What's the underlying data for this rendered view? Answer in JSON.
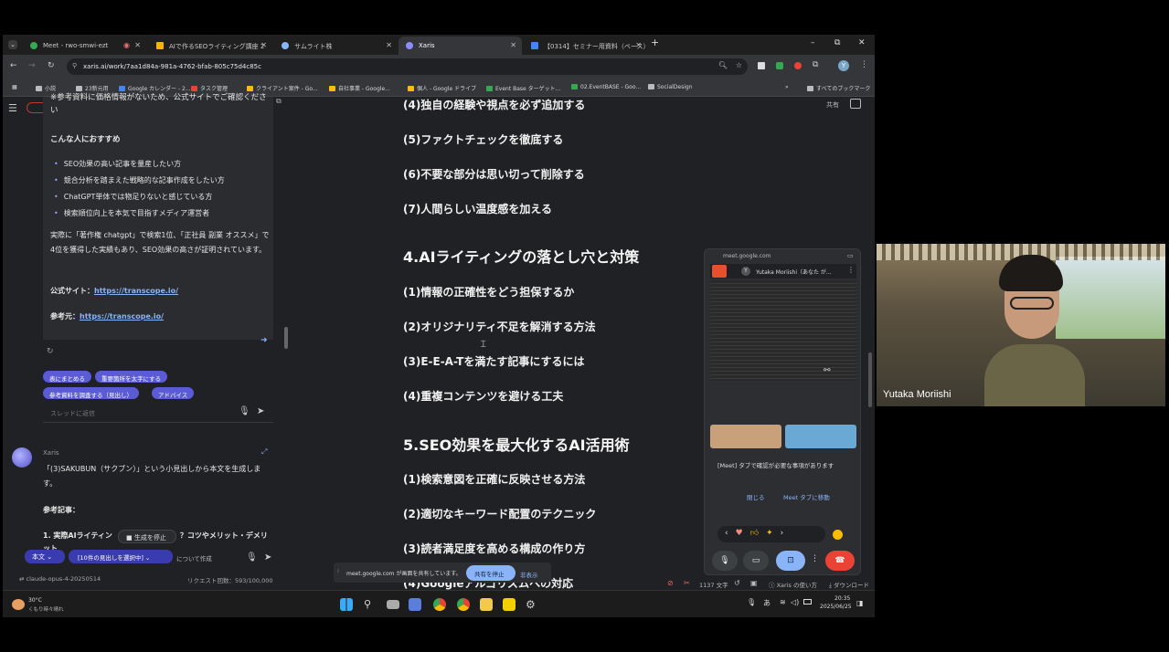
{
  "browser": {
    "tabs": [
      {
        "label": "Meet - rwo-smwi-ezt"
      },
      {
        "label": "AIで作るSEOライティング講座 2"
      },
      {
        "label": "サムライト株"
      },
      {
        "label": "Xaris"
      },
      {
        "label": "【0314】セミナー用資料（ベース）"
      }
    ],
    "url": "xaris.ai/work/7aa1d84a-981a-4762-bfab-805c75d4c85c",
    "bookmarks": [
      "小説",
      "23新元用",
      "Google カレンダー - 2...",
      "タスク管理",
      "クライアント案件 - Go...",
      "自社事業 - Google...",
      "個人 - Google ドライブ",
      "Event Base ターゲット...",
      "02.EventBASE - Goo...",
      "SocialDesign",
      "すべてのブックマーク"
    ]
  },
  "left_panel": {
    "note": "※参考資料に価格情報がないため、公式サイトでご確認ください",
    "recommend_title": "こんな人におすすめ",
    "recommend_items": [
      "SEO効果の高い記事を量産したい方",
      "競合分析を踏まえた戦略的な記事作成をしたい方",
      "ChatGPT単体では物足りないと感じている方",
      "検索順位向上を本気で目指すメディア運営者"
    ],
    "proof_text": "実際に「著作権 chatgpt」で検索1位、「正社員 副業 オススメ」で4位を獲得した実績もあり、SEO効果の高さが証明されています。",
    "official_label": "公式サイト：",
    "official_url": "https://transcope.io/",
    "ref_label": "参考元：",
    "ref_url": "https://transcope.io/",
    "chips": [
      "表にまとめる",
      "重要箇所を太字にする",
      "参考資料を調査する（見出し）",
      "アドバイス"
    ],
    "thread_placeholder": "スレッドに返信",
    "author": "Xaris",
    "reply": "「(3)SAKUBUN（サクブン）」という小見出しから本文を生成します。",
    "ref_articles_label": "参考記事：",
    "ref_article_1": "実際AIライティン",
    "ref_article_1_tail": "？コツやメリット・デメリット",
    "stop_button": "生成を停止",
    "mode_select": "本文",
    "heading_select": "10件の見出しを選択中",
    "heading_select_tail": "について作成",
    "model": "claude-opus-4-20250514",
    "request_count": "リクエスト回数：593/100,000"
  },
  "document": {
    "items_top": [
      "(4)独自の経験や視点を必ず追加する",
      "(5)ファクトチェックを徹底する",
      "(6)不要な部分は思い切って削除する",
      "(7)人間らしい温度感を加える"
    ],
    "section4": "4.AIライティングの落とし穴と対策",
    "section4_items": [
      "(1)情報の正確性をどう担保するか",
      "(2)オリジナリティ不足を解消する方法",
      "(3)E-E-A-Tを満たす記事にするには",
      "(4)重複コンテンツを避ける工夫"
    ],
    "section5": "5.SEO効果を最大化するAI活用術",
    "section5_items": [
      "(1)検索意図を正確に反映させる方法",
      "(2)適切なキーワード配置のテクニック",
      "(3)読者満足度を高める構成の作り方",
      "(4)Googleアルゴリズムへの対応"
    ],
    "share_label": "共有",
    "char_count": "1137 文字",
    "help": "Xaris の使い方",
    "download": "ダウンロード",
    "sharing_notice": "meet.google.com が画面を共有しています。",
    "stop_sharing": "共有を停止",
    "hide": "非表示"
  },
  "meet": {
    "host": "meet.google.com",
    "presenter": "Yutaka Moriishi（あなた が...",
    "notice": "[Meet] タブで確認が必要な事項があります",
    "close": "閉じる",
    "goto_tab": "Meet タブに移動"
  },
  "taskbar": {
    "weather_temp": "30°C",
    "weather_desc": "くもり時々晴れ",
    "ime": "あ",
    "time": "20:35",
    "date": "2025/06/25"
  },
  "camera": {
    "participant_name": "Yutaka Moriishi"
  }
}
